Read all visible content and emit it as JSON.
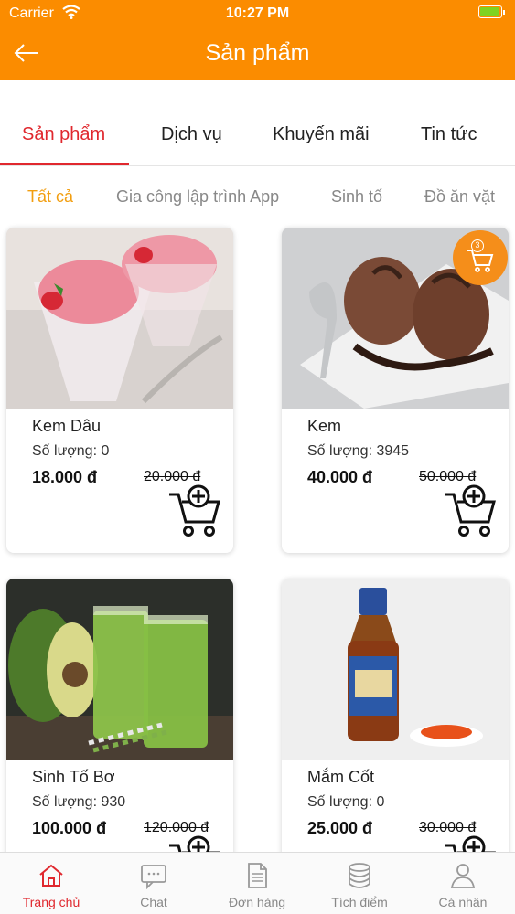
{
  "status_bar": {
    "carrier": "Carrier",
    "time": "10:27 PM"
  },
  "app_bar": {
    "title": "Sản phẩm"
  },
  "tabs": [
    {
      "label": "Sản phẩm",
      "active": true
    },
    {
      "label": "Dịch vụ",
      "active": false
    },
    {
      "label": "Khuyến mãi",
      "active": false
    },
    {
      "label": "Tin tức",
      "active": false
    }
  ],
  "categories": [
    {
      "label": "Tất cả",
      "active": true
    },
    {
      "label": "Gia công lập trình App",
      "active": false
    },
    {
      "label": "Sinh tố",
      "active": false
    },
    {
      "label": "Đồ ăn vặt",
      "active": false
    }
  ],
  "cart_badge": {
    "count": "3"
  },
  "products": [
    {
      "name": "Kem Dâu",
      "quantity": "Số lượng: 0",
      "price": "18.000 đ",
      "old_price": "20.000 đ",
      "image": "strawberry-ice-cream"
    },
    {
      "name": "Kem",
      "quantity": "Số lượng: 3945",
      "price": "40.000 đ",
      "old_price": "50.000 đ",
      "image": "chocolate-ice-cream"
    },
    {
      "name": "Sinh Tố Bơ",
      "quantity": "Số lượng: 930",
      "price": "100.000 đ",
      "old_price": "120.000 đ",
      "image": "avocado-smoothie"
    },
    {
      "name": "Mắm Cốt",
      "quantity": "Số lượng: 0",
      "price": "25.000 đ",
      "old_price": "30.000 đ",
      "image": "fish-sauce-bottle"
    }
  ],
  "bottom_nav": [
    {
      "label": "Trang chủ",
      "icon": "home-icon",
      "active": true
    },
    {
      "label": "Chat",
      "icon": "chat-icon",
      "active": false
    },
    {
      "label": "Đơn hàng",
      "icon": "document-icon",
      "active": false
    },
    {
      "label": "Tích điểm",
      "icon": "database-icon",
      "active": false
    },
    {
      "label": "Cá nhân",
      "icon": "person-icon",
      "active": false
    }
  ],
  "colors": {
    "primary": "#FB8C00",
    "accent": "#E0282E",
    "category_active": "#F29E10"
  }
}
